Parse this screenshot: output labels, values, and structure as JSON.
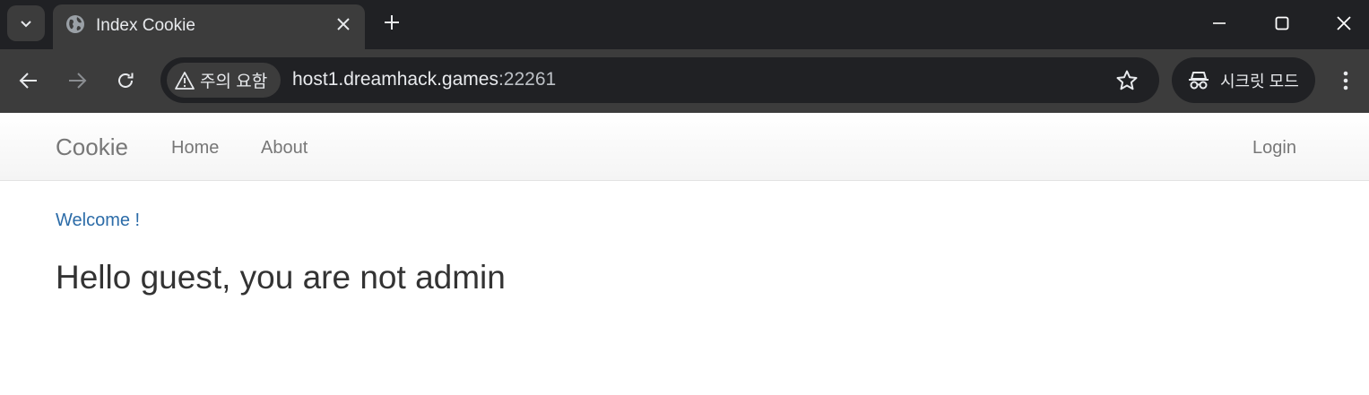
{
  "browser": {
    "tab": {
      "title": "Index Cookie"
    },
    "omnibox": {
      "security_label": "주의 요함",
      "url_host": "host1.dreamhack.games",
      "url_port": ":22261"
    },
    "incognito_label": "시크릿 모드",
    "icons": [
      "tab-search-icon",
      "globe-icon",
      "close-icon",
      "plus-icon",
      "minimize-icon",
      "maximize-icon",
      "window-close-icon",
      "back-arrow-icon",
      "forward-arrow-icon",
      "reload-icon",
      "warning-icon",
      "star-icon",
      "incognito-icon",
      "kebab-menu-icon"
    ]
  },
  "site": {
    "brand": "Cookie",
    "nav": {
      "home": "Home",
      "about": "About",
      "login": "Login"
    },
    "welcome": "Welcome !",
    "headline": "Hello guest, you are not admin"
  },
  "colors": {
    "chrome_dark": "#202124",
    "chrome_toolbar": "#3c3c3c",
    "link_blue": "#2c6ca8",
    "nav_text": "#777777",
    "heading_text": "#333333"
  }
}
